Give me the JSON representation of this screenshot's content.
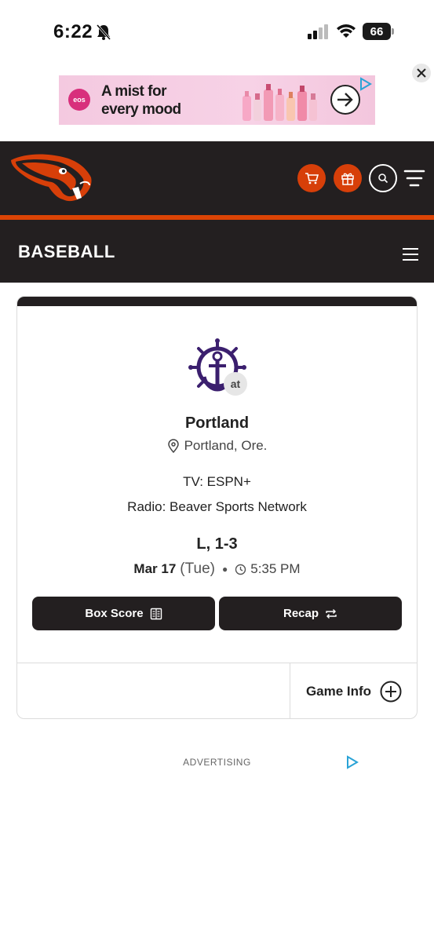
{
  "status_bar": {
    "time": "6:22",
    "battery": "66"
  },
  "ad": {
    "brand": "eos",
    "headline": "A mist for every mood"
  },
  "sport_bar": {
    "title": "BASEBALL"
  },
  "game": {
    "at_label": "at",
    "opponent": "Portland",
    "location": "Portland, Ore.",
    "tv": "TV: ESPN+",
    "radio": "Radio: Beaver Sports Network",
    "result": "L, 1-3",
    "date": "Mar 17",
    "day": "(Tue)",
    "time": "5:35 PM",
    "box_score_label": "Box Score",
    "recap_label": "Recap",
    "game_info_label": "Game Info"
  },
  "footer": {
    "advertising_label": "ADVERTISING"
  },
  "colors": {
    "brand_orange": "#d73f09",
    "header_black": "#231f20",
    "opponent_purple": "#3b1f6e"
  }
}
